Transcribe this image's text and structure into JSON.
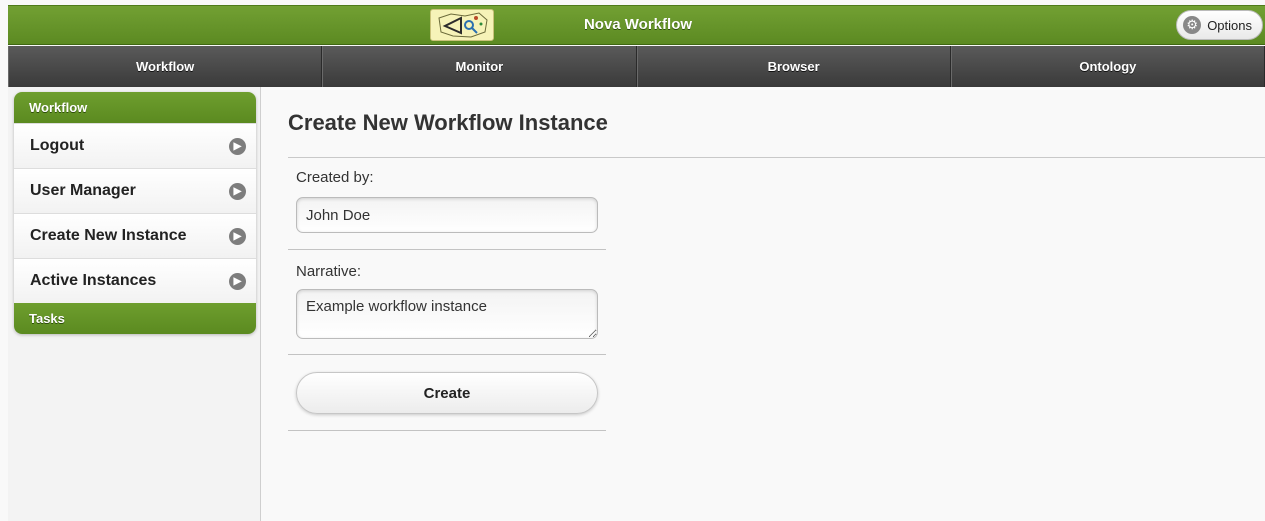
{
  "header": {
    "title": "Nova Workflow",
    "options_label": "Options",
    "brand_color": "#6a9a2a"
  },
  "nav": {
    "items": [
      {
        "label": "Workflow"
      },
      {
        "label": "Monitor"
      },
      {
        "label": "Browser"
      },
      {
        "label": "Ontology"
      }
    ]
  },
  "sidebar": {
    "section_workflow": "Workflow",
    "items": [
      {
        "label": "Logout",
        "icon": "chevron-right-icon"
      },
      {
        "label": "User Manager",
        "icon": "chevron-right-icon"
      },
      {
        "label": "Create New Instance",
        "icon": "chevron-right-icon"
      },
      {
        "label": "Active Instances",
        "icon": "chevron-right-icon"
      }
    ],
    "section_tasks": "Tasks"
  },
  "main": {
    "title": "Create New Workflow Instance",
    "created_by_label": "Created by:",
    "created_by_value": "John Doe",
    "narrative_label": "Narrative:",
    "narrative_value": "Example workflow instance",
    "create_label": "Create"
  }
}
